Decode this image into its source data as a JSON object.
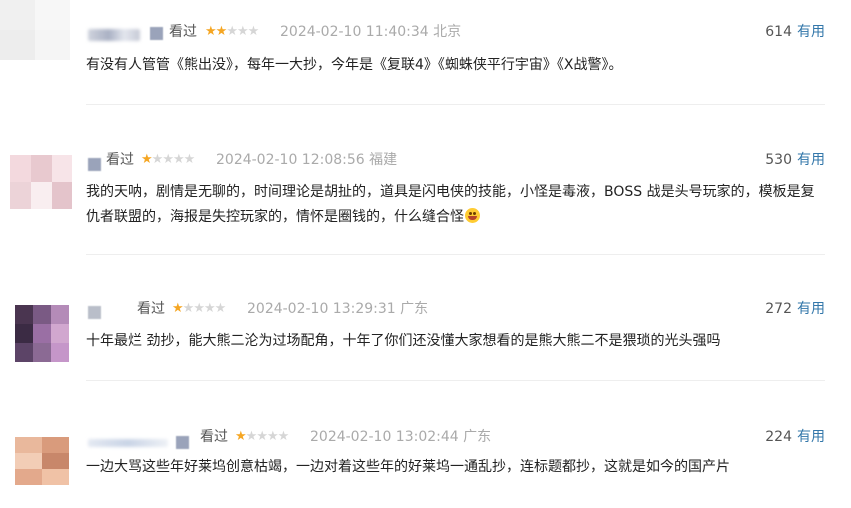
{
  "comments": [
    {
      "status": "看过",
      "rating": 2,
      "time": "2024-02-10 11:40:34",
      "location": "北京",
      "votes": "614",
      "useful_label": "有用",
      "text": "有没有人管管《熊出没》，每年一大抄，今年是《复联4》《蜘蛛侠平行宇宙》《X战警》。",
      "avatar_colors": [
        "#f0f0f0",
        "#f7f7f7",
        "#ededed",
        "#f5f5f5"
      ]
    },
    {
      "status": "看过",
      "rating": 1,
      "time": "2024-02-10 12:08:56",
      "location": "福建",
      "votes": "530",
      "useful_label": "有用",
      "text": "我的天呐，剧情是无聊的，时间理论是胡扯的，道具是闪电侠的技能，小怪是毒液，BOSS 战是头号玩家的，模板是复仇者联盟的，海报是失控玩家的，情怀是圈钱的，什么缝合怪",
      "emoji": "grinning-sweat-emoji",
      "avatar_colors": [
        "#f3d9de",
        "#e8c9cf",
        "#f7e4e8",
        "#ecd3d8",
        "#f9eef0",
        "#e4c4cb"
      ]
    },
    {
      "status": "看过",
      "rating": 1,
      "time": "2024-02-10 13:29:31",
      "location": "广东",
      "votes": "272",
      "useful_label": "有用",
      "text": "十年最烂 劲抄，能大熊二沦为过场配角，十年了你们还没懂大家想看的是熊大熊二不是猥琐的光头强吗",
      "avatar_colors": [
        "#4a3550",
        "#7a5a84",
        "#b48bb8",
        "#3b2b44",
        "#9a6fa4",
        "#d1a7cf",
        "#5c4467",
        "#8b6a94",
        "#c596c9"
      ]
    },
    {
      "status": "看过",
      "rating": 1,
      "time": "2024-02-10 13:02:44",
      "location": "广东",
      "votes": "224",
      "useful_label": "有用",
      "text": "一边大骂这些年好莱坞创意枯竭，一边对着这些年的好莱坞一通乱抄，连标题都抄，这就是如今的国产片",
      "avatar_colors": [
        "#e9b89c",
        "#d99b7c",
        "#f2cdb6",
        "#c8876a",
        "#e3a98c",
        "#f0c2a6"
      ]
    }
  ],
  "star_max": 5,
  "colors": {
    "star_on": "#f5a623",
    "star_off": "#d6d6d6",
    "useful_link": "#3377aa",
    "meta_gray": "#aaaaaa"
  }
}
